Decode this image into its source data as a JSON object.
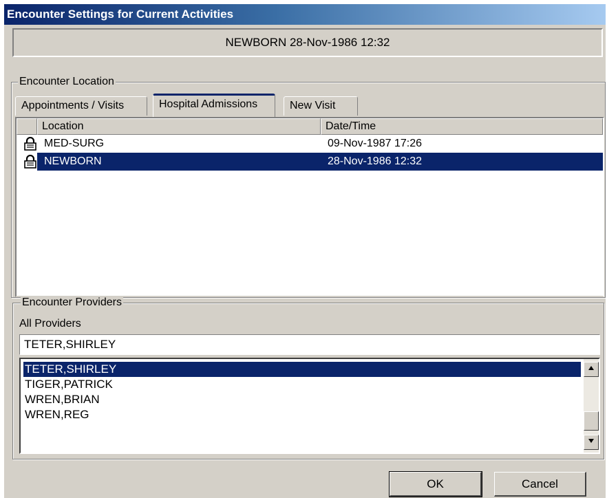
{
  "window": {
    "title": "Encounter Settings for Current Activities",
    "banner": "NEWBORN  28-Nov-1986 12:32"
  },
  "location_group": {
    "label": "Encounter Location",
    "tabs": [
      {
        "label": "Appointments / Visits",
        "active": false
      },
      {
        "label": "Hospital Admissions",
        "active": true
      },
      {
        "label": "New Visit",
        "active": false
      }
    ],
    "columns": {
      "location": "Location",
      "datetime": "Date/Time"
    },
    "rows": [
      {
        "location": "MED-SURG",
        "datetime": "09-Nov-1987 17:26",
        "icon": "lock-icon",
        "selected": false
      },
      {
        "location": "NEWBORN",
        "datetime": "28-Nov-1986 12:32",
        "icon": "lock-icon",
        "selected": true
      }
    ]
  },
  "providers_group": {
    "label": "Encounter Providers",
    "all_label": "All Providers",
    "search_value": "TETER,SHIRLEY",
    "items": [
      {
        "name": "TETER,SHIRLEY",
        "selected": true
      },
      {
        "name": "TIGER,PATRICK",
        "selected": false
      },
      {
        "name": "WREN,BRIAN",
        "selected": false
      },
      {
        "name": "WREN,REG",
        "selected": false
      }
    ]
  },
  "buttons": {
    "ok": "OK",
    "cancel": "Cancel"
  },
  "colors": {
    "selection": "#0a246a",
    "face": "#d4d0c8",
    "title_start": "#0a246a"
  }
}
